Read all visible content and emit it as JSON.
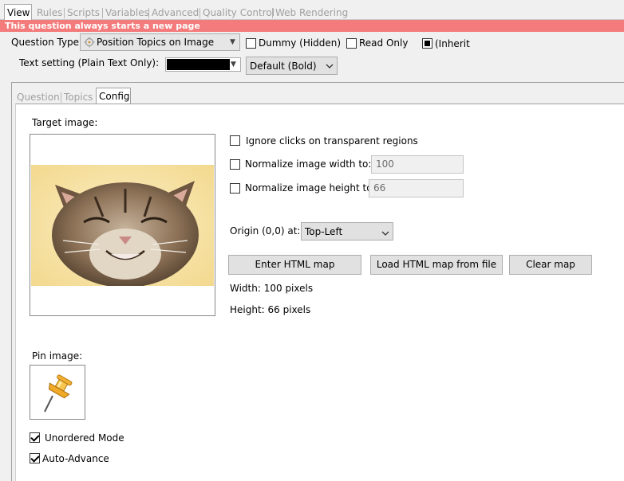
{
  "top_tabs": [
    "View",
    "Rules",
    "Scripts",
    "Variables",
    "Advanced",
    "Quality Control",
    "Web Rendering"
  ],
  "banner": "This question always starts a new page",
  "question_type": {
    "label": "Question Type:",
    "value": "Position Topics on Image"
  },
  "dummy_label": "Dummy (Hidden)",
  "read_only_label": "Read Only",
  "inherit_label": "(Inherit",
  "text_setting": {
    "label": "Text setting (Plain Text Only):",
    "color": "#000000",
    "font_value": "Default (Bold)"
  },
  "inner_tabs": [
    "Question",
    "Topics",
    "Config"
  ],
  "config": {
    "target_image_label": "Target image:",
    "ignore_clicks_label": "Ignore clicks on transparent regions",
    "normalize_width_label": "Normalize image width to:",
    "normalize_width_value": "100",
    "normalize_height_label": "Normalize image height to:",
    "normalize_height_value": "66",
    "origin_label": "Origin (0,0) at:",
    "origin_value": "Top-Left",
    "enter_map_label": "Enter HTML map",
    "load_map_label": "Load HTML map from file",
    "clear_map_label": "Clear map",
    "width_text": "Width: 100 pixels",
    "height_text": "Height: 66 pixels",
    "pin_image_label": "Pin image:",
    "unordered_mode_label": "Unordered Mode",
    "auto_advance_label": "Auto-Advance"
  }
}
